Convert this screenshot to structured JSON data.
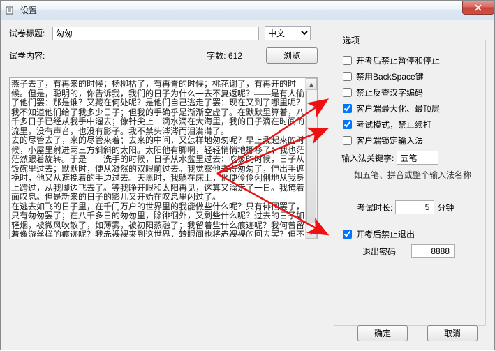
{
  "window": {
    "title": "设置"
  },
  "left": {
    "title_label": "试卷标题:",
    "title_value": "匆匆",
    "lang_options": [
      "中文"
    ],
    "lang_selected": "中文",
    "content_label": "试卷内容:",
    "wordcount_label": "字数:",
    "wordcount_value": "612",
    "browse_button": "浏览",
    "body_text": "燕子去了，有再来的时候；杨柳枯了，有再青的时候；桃花谢了，有再开的时候。但是，聪明的，你告诉我，我们的日子为什么一去不复返呢？——是有人偷了他们罢：那是谁？又藏在何处呢？是他们自己逃走了罢：现在又到了哪里呢？\n我不知道他们给了我多少日子；但我的手确乎是渐渐空虚了。在默默里算着，八千多日子已经从我手中溜去；像针尖上一滴水滴在大海里，我的日子滴在时间的流里，没有声音，也没有影子。我不禁头涔涔而泪潸潸了。\n去的尽管去了，来的尽管来着；去来的中间，又怎样地匆匆呢？早上我起来的时候，小屋里射进两三方斜斜的太阳。太阳他有脚啊，轻轻悄悄地挪移了；我也茫茫然跟着旋转。于是——洗手的时候，日子从水盆里过去；吃饭的时候，日子从饭碗里过去；默默时，便从凝然的双眼前过去。我觉察他去得匆匆了，伸出手遮挽时，他又从遮挽着的手边过去。天黑时，我躺在床上，他便伶伶俐俐地从我身上跨过，从我脚边飞去了。等我睁开眼和太阳再见，这算又溜走了一日。我掩着面叹息。但是新来的日子的影儿又开始在叹息里闪过了。\n在逃去如飞的日子里，在千门万户的世界里的我能做些什么呢？只有徘徊罢了，只有匆匆罢了；在八千多日的匆匆里，除徘徊外，又剩些什么呢？过去的日子如轻烟，被微风吹散了，如薄雾，被初阳蒸融了；我留着些什么痕迹呢？我何曾留着像游丝样的痕迹呢？我赤裸裸来到这世界，转眼间也将赤裸裸的回去罢？但不能平的，为什么偏要白白走这一遭啊？你聪明的，告诉我，我们的日子为什么一去不复返呢？"
  },
  "options": {
    "legend": "选项",
    "cb_pause": {
      "label": "开考后禁止暂停和停止",
      "checked": false
    },
    "cb_backspace": {
      "label": "禁用BackSpace键",
      "checked": false
    },
    "cb_hanzi": {
      "label": "禁止反查汉字编码",
      "checked": false
    },
    "cb_maximize": {
      "label": "客户端最大化、最顶层",
      "checked": true
    },
    "cb_exammode": {
      "label": "考试模式，禁止续打",
      "checked": true
    },
    "cb_lockime": {
      "label": "客户端锁定输入法",
      "checked": false
    },
    "ime_keyword_label": "输入法关键字:",
    "ime_keyword_value": "五笔",
    "ime_hint": "如五笔、拼音或整个输入法名称",
    "exam_time_label": "考试时长:",
    "exam_time_value": "5",
    "exam_time_unit": "分钟",
    "cb_noquit": {
      "label": "开考后禁止退出",
      "checked": true
    },
    "quit_pwd_label": "退出密码",
    "quit_pwd_value": "8888"
  },
  "buttons": {
    "ok": "确定",
    "cancel": "取消"
  }
}
